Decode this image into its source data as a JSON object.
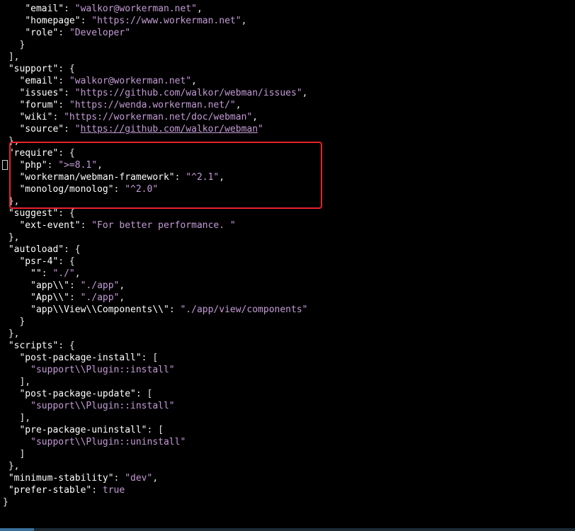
{
  "lines": [
    [
      [
        "    ",
        "punc"
      ],
      [
        "\"email\"",
        "key"
      ],
      [
        ": ",
        "punc"
      ],
      [
        "\"walkor@workerman.net\"",
        "str"
      ],
      [
        ",",
        "punc"
      ]
    ],
    [
      [
        "    ",
        "punc"
      ],
      [
        "\"homepage\"",
        "key"
      ],
      [
        ": ",
        "punc"
      ],
      [
        "\"https://www.workerman.net\"",
        "str"
      ],
      [
        ",",
        "punc"
      ]
    ],
    [
      [
        "    ",
        "punc"
      ],
      [
        "\"role\"",
        "key"
      ],
      [
        ": ",
        "punc"
      ],
      [
        "\"Developer\"",
        "str"
      ]
    ],
    [
      [
        "   }",
        "punc"
      ]
    ],
    [
      [
        " ],",
        "punc"
      ]
    ],
    [
      [
        " ",
        "punc"
      ],
      [
        "\"support\"",
        "key"
      ],
      [
        ": {",
        "punc"
      ]
    ],
    [
      [
        "   ",
        "punc"
      ],
      [
        "\"email\"",
        "key"
      ],
      [
        ": ",
        "punc"
      ],
      [
        "\"walkor@workerman.net\"",
        "str"
      ],
      [
        ",",
        "punc"
      ]
    ],
    [
      [
        "   ",
        "punc"
      ],
      [
        "\"issues\"",
        "key"
      ],
      [
        ": ",
        "punc"
      ],
      [
        "\"https://github.com/walkor/webman/issues\"",
        "str"
      ],
      [
        ",",
        "punc"
      ]
    ],
    [
      [
        "   ",
        "punc"
      ],
      [
        "\"forum\"",
        "key"
      ],
      [
        ": ",
        "punc"
      ],
      [
        "\"https://wenda.workerman.net/\"",
        "str"
      ],
      [
        ",",
        "punc"
      ]
    ],
    [
      [
        "   ",
        "punc"
      ],
      [
        "\"wiki\"",
        "key"
      ],
      [
        ": ",
        "punc"
      ],
      [
        "\"https://workerman.net/doc/webman\"",
        "str"
      ],
      [
        ",",
        "punc"
      ]
    ],
    [
      [
        "   ",
        "punc"
      ],
      [
        "\"source\"",
        "key"
      ],
      [
        ": ",
        "punc"
      ],
      [
        "\"",
        "str"
      ],
      [
        "https://github.com/walkor/webman",
        "link"
      ],
      [
        "\"",
        "str"
      ]
    ],
    [
      [
        " },",
        "punc"
      ]
    ],
    [
      [
        " ",
        "punc"
      ],
      [
        "\"require\"",
        "key"
      ],
      [
        ": {",
        "punc"
      ]
    ],
    [
      [
        "   ",
        "punc"
      ],
      [
        "\"php\"",
        "key"
      ],
      [
        ": ",
        "punc"
      ],
      [
        "\">=8.1\"",
        "str"
      ],
      [
        ",",
        "punc"
      ]
    ],
    [
      [
        "   ",
        "punc"
      ],
      [
        "\"workerman/webman-framework\"",
        "key"
      ],
      [
        ": ",
        "punc"
      ],
      [
        "\"^2.1\"",
        "str"
      ],
      [
        ",",
        "punc"
      ]
    ],
    [
      [
        "   ",
        "punc"
      ],
      [
        "\"monolog/monolog\"",
        "key"
      ],
      [
        ": ",
        "punc"
      ],
      [
        "\"^2.0\"",
        "str"
      ]
    ],
    [
      [
        " },",
        "punc"
      ]
    ],
    [
      [
        " ",
        "punc"
      ],
      [
        "\"suggest\"",
        "key"
      ],
      [
        ": {",
        "punc"
      ]
    ],
    [
      [
        "   ",
        "punc"
      ],
      [
        "\"ext-event\"",
        "key"
      ],
      [
        ": ",
        "punc"
      ],
      [
        "\"For better performance. \"",
        "str"
      ]
    ],
    [
      [
        " },",
        "punc"
      ]
    ],
    [
      [
        " ",
        "punc"
      ],
      [
        "\"autoload\"",
        "key"
      ],
      [
        ": {",
        "punc"
      ]
    ],
    [
      [
        "   ",
        "punc"
      ],
      [
        "\"psr-4\"",
        "key"
      ],
      [
        ": {",
        "punc"
      ]
    ],
    [
      [
        "     ",
        "punc"
      ],
      [
        "\"\"",
        "key"
      ],
      [
        ": ",
        "punc"
      ],
      [
        "\"./\"",
        "str"
      ],
      [
        ",",
        "punc"
      ]
    ],
    [
      [
        "     ",
        "punc"
      ],
      [
        "\"app\\\\\"",
        "key"
      ],
      [
        ": ",
        "punc"
      ],
      [
        "\"./app\"",
        "str"
      ],
      [
        ",",
        "punc"
      ]
    ],
    [
      [
        "     ",
        "punc"
      ],
      [
        "\"App\\\\\"",
        "key"
      ],
      [
        ": ",
        "punc"
      ],
      [
        "\"./app\"",
        "str"
      ],
      [
        ",",
        "punc"
      ]
    ],
    [
      [
        "     ",
        "punc"
      ],
      [
        "\"app\\\\View\\\\Components\\\\\"",
        "key"
      ],
      [
        ": ",
        "punc"
      ],
      [
        "\"./app/view/components\"",
        "str"
      ]
    ],
    [
      [
        "   }",
        "punc"
      ]
    ],
    [
      [
        " },",
        "punc"
      ]
    ],
    [
      [
        " ",
        "punc"
      ],
      [
        "\"scripts\"",
        "key"
      ],
      [
        ": {",
        "punc"
      ]
    ],
    [
      [
        "   ",
        "punc"
      ],
      [
        "\"post-package-install\"",
        "key"
      ],
      [
        ": [",
        "punc"
      ]
    ],
    [
      [
        "     ",
        "punc"
      ],
      [
        "\"support\\\\Plugin::install\"",
        "str"
      ]
    ],
    [
      [
        "   ],",
        "punc"
      ]
    ],
    [
      [
        "   ",
        "punc"
      ],
      [
        "\"post-package-update\"",
        "key"
      ],
      [
        ": [",
        "punc"
      ]
    ],
    [
      [
        "     ",
        "punc"
      ],
      [
        "\"support\\\\Plugin::install\"",
        "str"
      ]
    ],
    [
      [
        "   ],",
        "punc"
      ]
    ],
    [
      [
        "   ",
        "punc"
      ],
      [
        "\"pre-package-uninstall\"",
        "key"
      ],
      [
        ": [",
        "punc"
      ]
    ],
    [
      [
        "     ",
        "punc"
      ],
      [
        "\"support\\\\Plugin::uninstall\"",
        "str"
      ]
    ],
    [
      [
        "   ]",
        "punc"
      ]
    ],
    [
      [
        " },",
        "punc"
      ]
    ],
    [
      [
        " ",
        "punc"
      ],
      [
        "\"minimum-stability\"",
        "key"
      ],
      [
        ": ",
        "punc"
      ],
      [
        "\"dev\"",
        "str"
      ],
      [
        ",",
        "punc"
      ]
    ],
    [
      [
        " ",
        "punc"
      ],
      [
        "\"prefer-stable\"",
        "key"
      ],
      [
        ": ",
        "punc"
      ],
      [
        "true",
        "kw"
      ]
    ],
    [
      [
        "}",
        "punc"
      ]
    ]
  ],
  "colors": {
    "background": "#000000",
    "key": "#ffffff",
    "string": "#c49bd6",
    "highlight_border": "#e8222b"
  }
}
